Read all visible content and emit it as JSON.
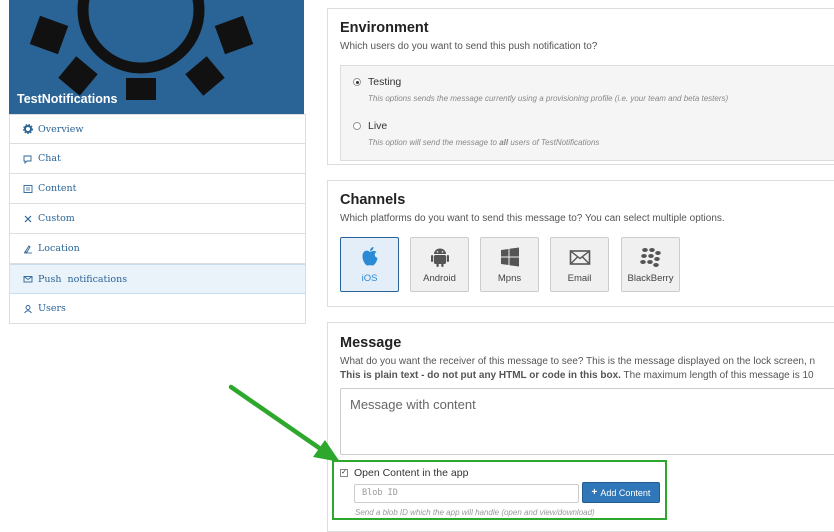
{
  "sidebar": {
    "app_name": "TestNotifications",
    "items": [
      {
        "label": "Overview",
        "icon": "gear-icon"
      },
      {
        "label": "Chat",
        "icon": "chat-icon"
      },
      {
        "label": "Content",
        "icon": "content-icon"
      },
      {
        "label": "Custom",
        "icon": "tools-icon"
      },
      {
        "label": "Location",
        "icon": "location-icon"
      },
      {
        "label": "Push  notifications",
        "icon": "envelope-icon",
        "active": true
      },
      {
        "label": "Users",
        "icon": "users-icon"
      }
    ]
  },
  "environment": {
    "title": "Environment",
    "subtitle": "Which users do you want to send this push notification to?",
    "options": [
      {
        "label": "Testing",
        "help": "This options sends the message currently using a provisioning profile (i.e. your team and beta testers)",
        "selected": true
      },
      {
        "label": "Live",
        "help_prefix": "This option will send the message to ",
        "help_emph": "all",
        "help_suffix": " users of TestNotifications",
        "selected": false
      }
    ]
  },
  "channels": {
    "title": "Channels",
    "subtitle": "Which platforms do you want to send this message to? You can select multiple options.",
    "items": [
      {
        "label": "iOS",
        "icon": "apple-icon",
        "selected": true
      },
      {
        "label": "Android",
        "icon": "android-icon",
        "selected": false
      },
      {
        "label": "Mpns",
        "icon": "windows-icon",
        "selected": false
      },
      {
        "label": "Email",
        "icon": "envelope-icon",
        "selected": false
      },
      {
        "label": "BlackBerry",
        "icon": "blackberry-icon",
        "selected": false
      }
    ]
  },
  "message": {
    "title": "Message",
    "subtitle": "What do you want the receiver of this message to see? This is the message displayed on the lock screen, n",
    "note_bold": "This is plain text - do not put any HTML or code in this box.",
    "note_rest": " The maximum length of this message is 10",
    "text_value": "Message with content",
    "open_content_label": "Open Content in the app",
    "open_content_checked": true,
    "blob_placeholder": "Blob ID",
    "add_button_label": "Add Content",
    "blob_help": "Send a blob ID which the app will handle (open and view/download)"
  },
  "colors": {
    "accent": "#2a6496",
    "highlight": "#2ea82c",
    "button": "#2f77b9"
  }
}
